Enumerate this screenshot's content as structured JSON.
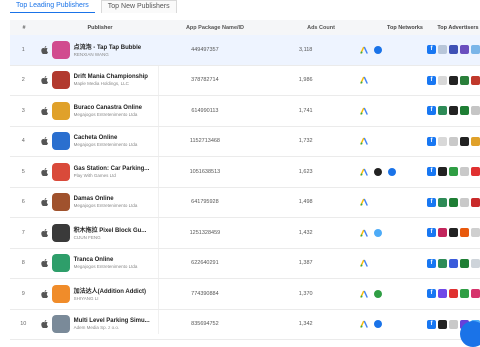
{
  "tabs": [
    {
      "label": "Top Leading Publishers",
      "active": true
    },
    {
      "label": "Top New Publishers",
      "active": false
    }
  ],
  "headers": {
    "rank": "#",
    "publisher": "Publisher",
    "package": "App Package Name/ID",
    "ads": "Ads Count",
    "networks": "Top Networks",
    "advertisers": "Top Advertisers"
  },
  "colors": {
    "accent": "#1a73e8",
    "highlight_row": "#eef4ff",
    "facebook": "#1877f2"
  },
  "rows": [
    {
      "rank": "1",
      "name": "点流泡 - Tap Tap Bubble",
      "sub": "RENXIAN WANG",
      "pkg": "449497357",
      "ads": "3,118",
      "icon": "#d14b8f",
      "networks": [
        "google-ads-icon",
        "circle-blue"
      ],
      "adv": [
        "facebook-icon",
        "#b8c6d9",
        "#3f51b5",
        "#6a4fbf",
        "#7ab5e8"
      ]
    },
    {
      "rank": "2",
      "name": "Drift Mania Championship",
      "sub": "Maple Media Holdings, LLC",
      "pkg": "378782714",
      "ads": "1,986",
      "icon": "#b23a2f",
      "networks": [
        "google-ads-icon"
      ],
      "adv": [
        "facebook-icon",
        "#d8d8d8",
        "#222222",
        "#2a7f3a",
        "#c0392b"
      ]
    },
    {
      "rank": "3",
      "name": "Buraco Canastra Online",
      "sub": "Megajogos Entretenimento Ltda",
      "pkg": "614990113",
      "ads": "1,741",
      "icon": "#e0a12a",
      "networks": [
        "google-ads-icon"
      ],
      "adv": [
        "facebook-icon",
        "#2e8b57",
        "#222222",
        "#1e7e34",
        "#c5c5c5"
      ]
    },
    {
      "rank": "4",
      "name": "Cacheta Online",
      "sub": "Megajogos Entretenimento Ltda",
      "pkg": "1152713468",
      "ads": "1,732",
      "icon": "#2a6fcf",
      "networks": [
        "google-ads-icon"
      ],
      "adv": [
        "facebook-icon",
        "#d8d8d8",
        "#c9c9c9",
        "#222222",
        "#e0a12a"
      ]
    },
    {
      "rank": "5",
      "name": "Gas Station: Car Parking...",
      "sub": "Play With Games Ltd",
      "pkg": "1051638513",
      "ads": "1,623",
      "icon": "#d94a3a",
      "networks": [
        "google-ads-icon",
        "circle-dark",
        "circle-blue"
      ],
      "adv": [
        "facebook-icon",
        "#222222",
        "#2f9e44",
        "#c9c9c9",
        "#e03131"
      ]
    },
    {
      "rank": "6",
      "name": "Damas Online",
      "sub": "Megajogos Entretenimento Ltda",
      "pkg": "641795928",
      "ads": "1,498",
      "icon": "#a0522d",
      "networks": [
        "google-ads-icon"
      ],
      "adv": [
        "facebook-icon",
        "#2e8b57",
        "#1e7e34",
        "#c9c9c9",
        "#c92a2a"
      ]
    },
    {
      "rank": "7",
      "name": "积木拖拉 Pixel Block Gu...",
      "sub": "CIJUN FENG",
      "pkg": "1251328459",
      "ads": "1,432",
      "icon": "#3a3a3a",
      "networks": [
        "google-ads-icon",
        "circle-teal"
      ],
      "adv": [
        "facebook-icon",
        "#c2255c",
        "#222222",
        "#e8590c",
        "#cfcfcf"
      ]
    },
    {
      "rank": "8",
      "name": "Tranca Online",
      "sub": "Megajogos Entretenimento Ltda",
      "pkg": "622640291",
      "ads": "1,387",
      "icon": "#2e9e6a",
      "networks": [
        "google-ads-icon"
      ],
      "adv": [
        "facebook-icon",
        "#2e8b57",
        "#3b5bdb",
        "#1e7e34",
        "#ced4da"
      ]
    },
    {
      "rank": "9",
      "name": "加法达人(Addition Addict)",
      "sub": "SHIYANG LI",
      "pkg": "774390884",
      "ads": "1,370",
      "icon": "#f08c2a",
      "networks": [
        "google-ads-icon",
        "circle-green"
      ],
      "adv": [
        "facebook-icon",
        "#7048e8",
        "#e03131",
        "#2f9e44",
        "#d6336c"
      ]
    },
    {
      "rank": "10",
      "name": "Multi Level Parking Simu...",
      "sub": "Adem Media Sp. z o.o.",
      "pkg": "835694752",
      "ads": "1,342",
      "icon": "#7a8a99",
      "networks": [
        "google-ads-icon",
        "circle-blue"
      ],
      "adv": [
        "facebook-icon",
        "#222222",
        "#c9c9c9",
        "#6741d9",
        "#4dabf7"
      ]
    }
  ]
}
